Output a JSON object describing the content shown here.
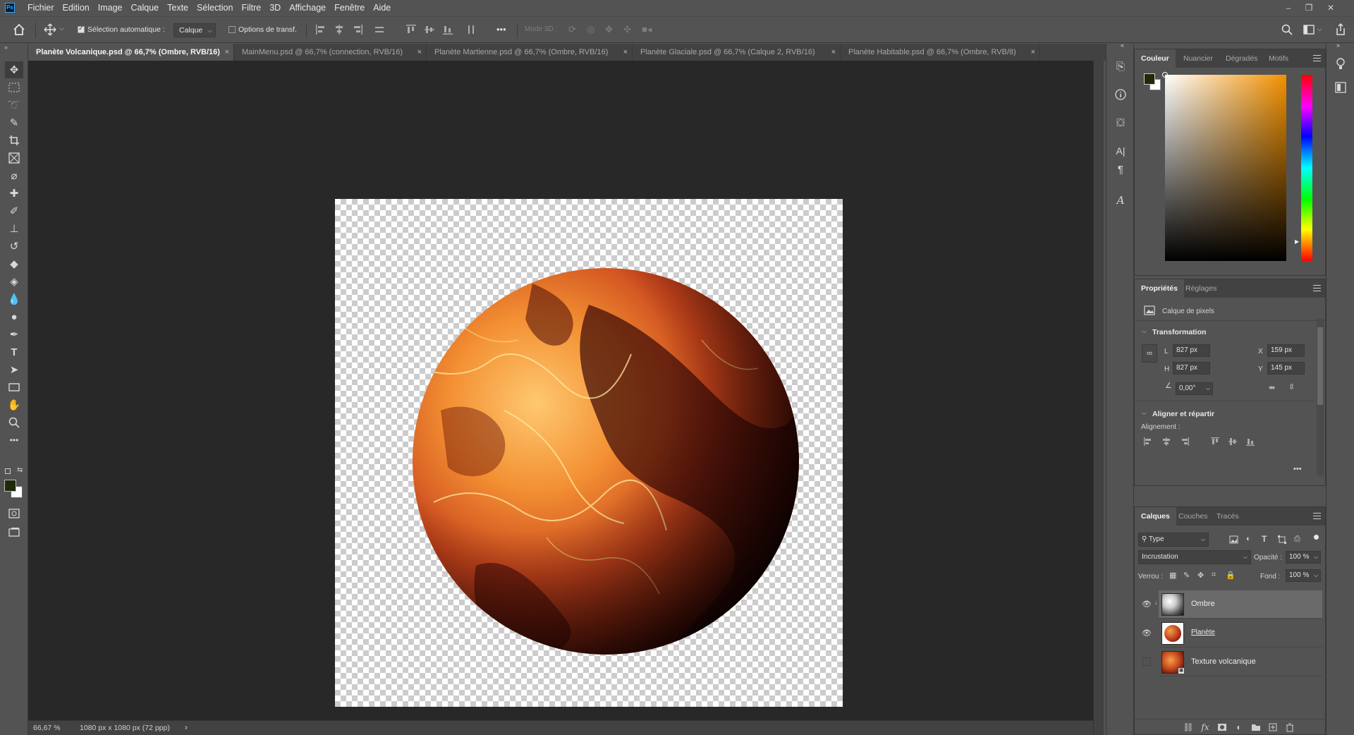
{
  "app": {
    "logo": "Ps",
    "menu": [
      "Fichier",
      "Edition",
      "Image",
      "Calque",
      "Texte",
      "Sélection",
      "Filtre",
      "3D",
      "Affichage",
      "Fenêtre",
      "Aide"
    ]
  },
  "options": {
    "auto_select_label": "Sélection automatique :",
    "auto_select_checked": true,
    "auto_select_target": "Calque",
    "transform_controls_label": "Options de transf.",
    "transform_controls_checked": false,
    "more": "•••",
    "mode3d_label": "Mode 3D :"
  },
  "tabs": [
    {
      "label": "Planète Volcanique.psd @ 66,7% (Ombre, RVB/16)",
      "active": true
    },
    {
      "label": "MainMenu.psd @ 66,7% (connection, RVB/16)",
      "active": false
    },
    {
      "label": "Planète Martienne.psd @ 66,7% (Ombre, RVB/16)",
      "active": false
    },
    {
      "label": "Planète Glaciale.psd @ 66,7% (Calque 2, RVB/16)",
      "active": false
    },
    {
      "label": "Planète Habitable.psd @ 66,7% (Ombre, RVB/8)",
      "active": false
    }
  ],
  "tab_close": "×",
  "status": {
    "zoom": "66,67 %",
    "doc_info": "1080 px x 1080 px (72 ppp)",
    "arrow": "›"
  },
  "colors": {
    "foreground": "#1e2a08",
    "background": "#ffffff",
    "canvas_bg": "#282828",
    "ui_panel": "#535353"
  },
  "color_panel": {
    "tabs": [
      "Couleur",
      "Nuancier",
      "Dégradés",
      "Motifs"
    ],
    "hue": "orange"
  },
  "properties_panel": {
    "tabs": [
      "Propriétés",
      "Réglages"
    ],
    "layer_kind": "Calque de pixels",
    "transform_title": "Transformation",
    "w_label": "L",
    "w_value": "827 px",
    "h_label": "H",
    "h_value": "827 px",
    "x_label": "X",
    "x_value": "159 px",
    "y_label": "Y",
    "y_value": "145 px",
    "angle_value": "0,00°",
    "align_title": "Aligner et répartir",
    "align_label": "Alignement :",
    "more": "•••"
  },
  "layers_panel": {
    "tabs": [
      "Calques",
      "Couches",
      "Tracés"
    ],
    "filter_type": "Type",
    "blend_mode": "Incrustation",
    "opacity_label": "Opacité :",
    "opacity_value": "100 %",
    "lock_label": "Verrou :",
    "fill_label": "Fond :",
    "fill_value": "100 %",
    "layers": [
      {
        "name": "Ombre",
        "visible": true,
        "selected": true
      },
      {
        "name": "Planète",
        "visible": true,
        "selected": false
      },
      {
        "name": "Texture volcanique",
        "visible": false,
        "selected": false
      }
    ]
  }
}
